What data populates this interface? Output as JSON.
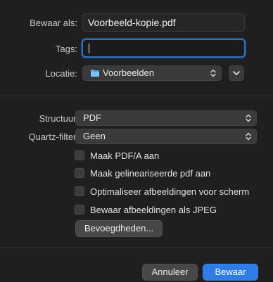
{
  "save_as": {
    "label": "Bewaar als:",
    "value": "Voorbeeld-kopie.pdf"
  },
  "tags": {
    "label": "Tags:",
    "value": ""
  },
  "location": {
    "label": "Locatie:",
    "value": "Voorbeelden",
    "icon": "folder-icon"
  },
  "structure": {
    "label": "Structuur:",
    "value": "PDF"
  },
  "quartz_filter": {
    "label": "Quartz-filter:",
    "value": "Geen"
  },
  "options": [
    {
      "label": "Maak PDF/A aan",
      "checked": false
    },
    {
      "label": "Maak gelineariseerde pdf aan",
      "checked": false
    },
    {
      "label": "Optimaliseer afbeeldingen voor scherm",
      "checked": false
    },
    {
      "label": "Bewaar afbeeldingen als JPEG",
      "checked": false
    }
  ],
  "permissions_button": "Bevoegdheden...",
  "buttons": {
    "cancel": "Annuleer",
    "save": "Bewaar"
  },
  "colors": {
    "accent": "#2f7ce6",
    "focus_ring": "#2f6fb8",
    "folder": "#5aa9f5"
  }
}
